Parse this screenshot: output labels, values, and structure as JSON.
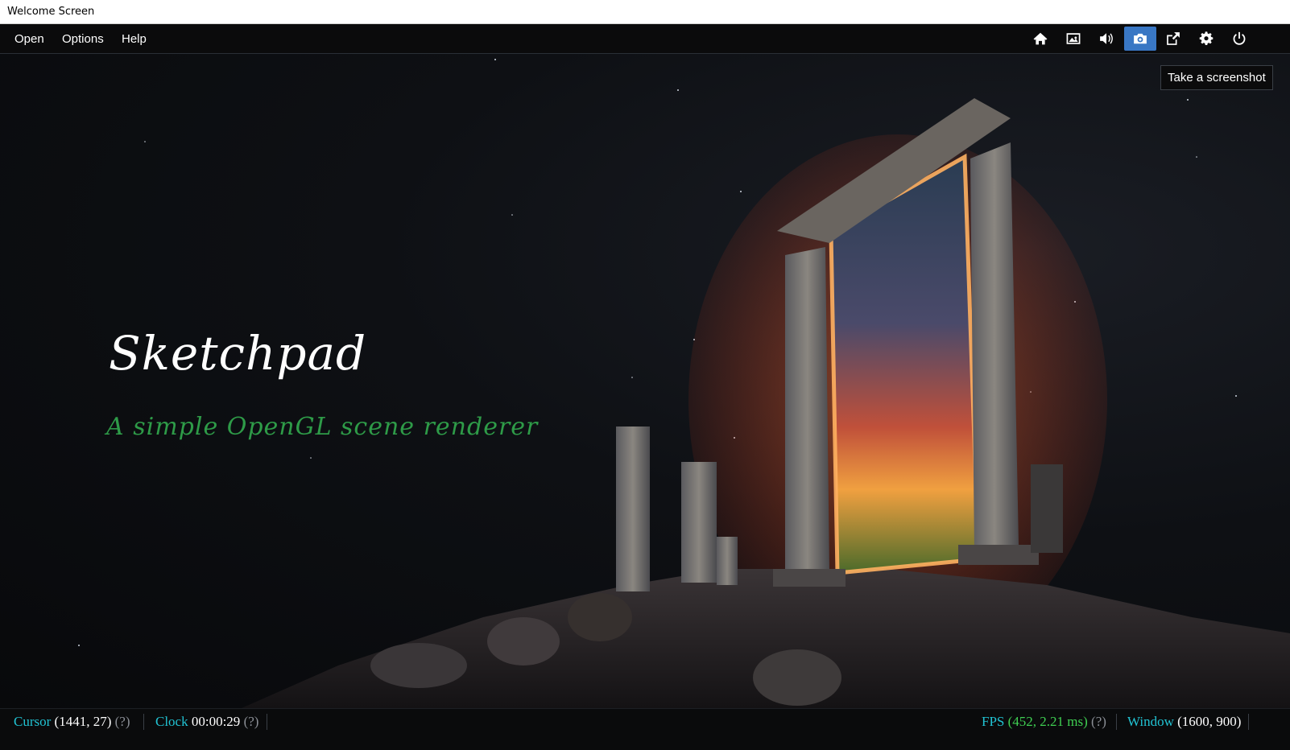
{
  "window": {
    "title": "Welcome Screen"
  },
  "menu": {
    "items": [
      "Open",
      "Options",
      "Help"
    ]
  },
  "toolbar": {
    "buttons": [
      {
        "icon": "home-icon"
      },
      {
        "icon": "image-icon"
      },
      {
        "icon": "volume-icon"
      },
      {
        "icon": "camera-icon",
        "active": true
      },
      {
        "icon": "external-link-icon"
      },
      {
        "icon": "gear-icon"
      },
      {
        "icon": "power-icon"
      }
    ],
    "tooltip": "Take a screenshot"
  },
  "hero": {
    "title": "Sketchpad",
    "subtitle": "A simple OpenGL scene renderer"
  },
  "status": {
    "cursor": {
      "label": "Cursor",
      "value": "(1441, 27)",
      "help": "(?)"
    },
    "clock": {
      "label": "Clock",
      "value": "00:00:29",
      "help": "(?)"
    },
    "fps": {
      "label": "FPS",
      "value": "(452, 2.21 ms)",
      "help": "(?)"
    },
    "window": {
      "label": "Window",
      "value": "(1600, 900)"
    }
  },
  "colors": {
    "accent": "#3977c4",
    "status_label": "#21c3d3",
    "subtitle": "#2e9b48",
    "fps_value": "#3fcf52"
  }
}
